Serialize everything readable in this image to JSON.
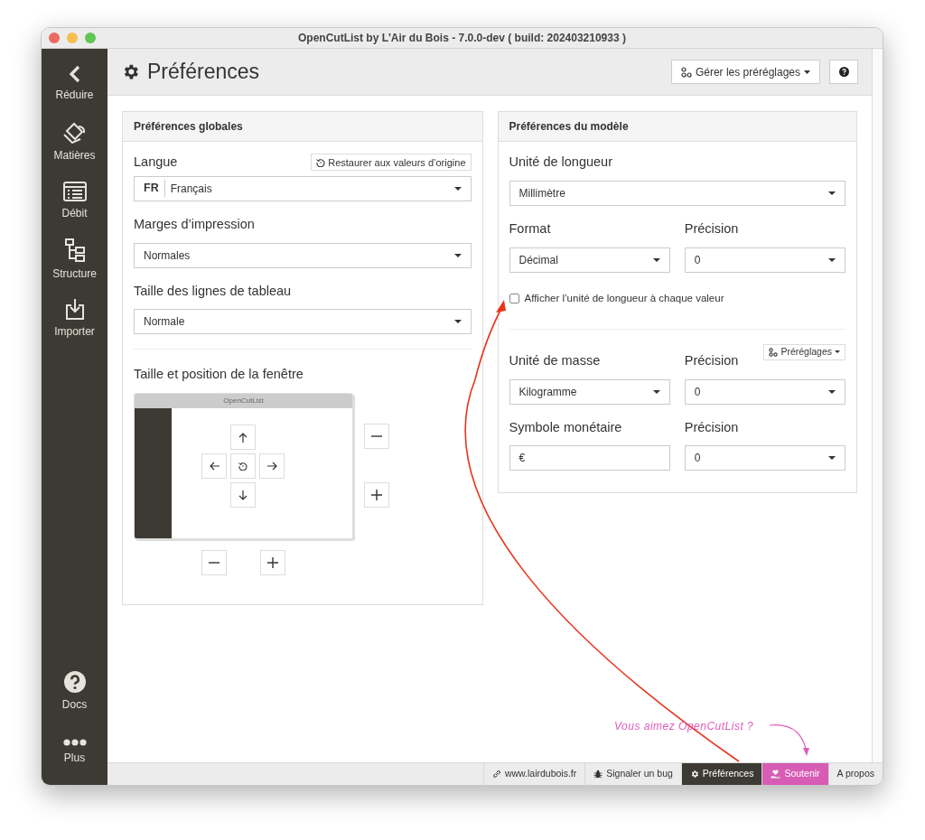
{
  "window": {
    "title": "OpenCutList by L'Air du Bois - 7.0.0-dev ( build: 202403210933 )"
  },
  "sidebar": {
    "items": [
      {
        "label": "Réduire"
      },
      {
        "label": "Matières"
      },
      {
        "label": "Débit"
      },
      {
        "label": "Structure"
      },
      {
        "label": "Importer"
      }
    ],
    "bottom_items": [
      {
        "label": "Docs"
      },
      {
        "label": "Plus"
      }
    ]
  },
  "header": {
    "title": "Préférences",
    "presets_button": "Gérer les préréglages"
  },
  "global_panel": {
    "title": "Préférences globales",
    "restore_button": "Restaurer aux valeurs d’origine",
    "language": {
      "label": "Langue",
      "code": "FR",
      "value": "Français"
    },
    "fields": [
      {
        "label": "Marges d’impression",
        "value": "Normales"
      },
      {
        "label": "Taille des lignes de tableau",
        "value": "Normale"
      }
    ],
    "window_section": {
      "label": "Taille et position de la fenêtre",
      "preview_title": "OpenCutList"
    }
  },
  "model_panel": {
    "title": "Préférences du modèle",
    "length_unit": {
      "label": "Unité de longueur",
      "value": "Millimètre"
    },
    "format": {
      "label": "Format",
      "value": "Décimal"
    },
    "length_precision": {
      "label": "Précision",
      "value": "0"
    },
    "show_unit": {
      "label": "Afficher l’unité de longueur à chaque valeur",
      "checked": false
    },
    "presets_button": "Préréglages",
    "mass_unit": {
      "label": "Unité de masse",
      "value": "Kilogramme"
    },
    "mass_precision": {
      "label": "Précision",
      "value": "0"
    },
    "currency": {
      "label": "Symbole monétaire",
      "value": "€"
    },
    "currency_precision": {
      "label": "Précision",
      "value": "0"
    }
  },
  "footer": {
    "items": [
      {
        "label": "www.lairdubois.fr",
        "kind": "link",
        "selected": false
      },
      {
        "label": "Signaler un bug",
        "kind": "bug",
        "selected": false
      },
      {
        "label": "Préférences",
        "kind": "settings",
        "selected": true
      },
      {
        "label": "Soutenir",
        "kind": "support",
        "selected": false
      },
      {
        "label": "A propos",
        "kind": "plain",
        "selected": false
      }
    ]
  },
  "annotation": {
    "text": "Vous aimez OpenCutList ?"
  }
}
